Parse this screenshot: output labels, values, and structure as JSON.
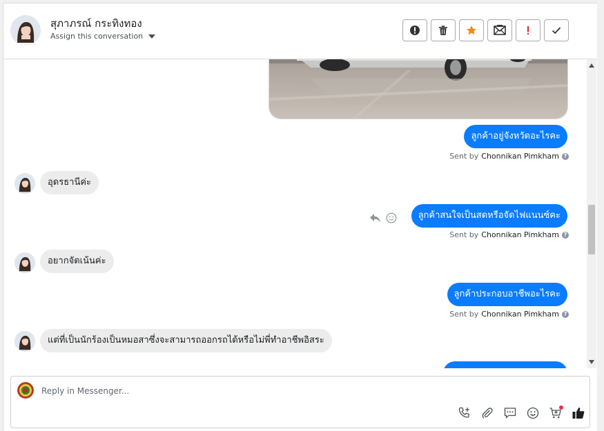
{
  "header": {
    "contact_name": "สุภาภรณ์ กระทิงทอง",
    "assign_label": "Assign this conversation",
    "actions": [
      {
        "name": "spam-button",
        "icon": "alert-circle-icon"
      },
      {
        "name": "delete-button",
        "icon": "trash-icon"
      },
      {
        "name": "star-button",
        "icon": "star-icon"
      },
      {
        "name": "mark-unread-button",
        "icon": "envelope-icon"
      },
      {
        "name": "follow-up-button",
        "icon": "exclamation-icon"
      },
      {
        "name": "done-button",
        "icon": "checkmark-icon"
      }
    ]
  },
  "messages": [
    {
      "direction": "out",
      "type": "image",
      "icon": "car-photo"
    },
    {
      "direction": "out",
      "text": "ลูกค้าอยู่จังหวัดอะไรคะ",
      "sent_by_prefix": "Sent by",
      "agent": "Chonnikan Pimkham"
    },
    {
      "direction": "in",
      "text": "อุดรธานีค่ะ"
    },
    {
      "direction": "out",
      "text": "ลูกค้าสนใจเป็นสดหรือจัดไฟแนนซ์คะ",
      "sent_by_prefix": "Sent by",
      "agent": "Chonnikan Pimkham"
    },
    {
      "direction": "in",
      "text": "อยากจัดเน้นค่ะ"
    },
    {
      "direction": "out",
      "text": "ลูกค้าประกอบอาชีพอะไรคะ",
      "sent_by_prefix": "Sent by",
      "agent": "Chonnikan Pimkham"
    },
    {
      "direction": "in",
      "text": "แต่ที่เป็นนักร้องเป็นหมอสาซึ่งจะสามารถออกรถได้หรือไม่พี่ทำอาชีพอิสระ"
    }
  ],
  "help_glyph": "?",
  "composer": {
    "placeholder": "Reply in Messenger...",
    "tools": [
      "phone-plus-icon",
      "paperclip-icon",
      "saved-reply-icon",
      "emoji-icon",
      "cart-icon",
      "thumbs-up-icon"
    ]
  },
  "colors": {
    "outgoing_bubble": "#0a7cff",
    "incoming_bubble": "#ececec",
    "star": "#f28a1b",
    "follow_up": "#e4231c",
    "notification_dot": "#f02849"
  }
}
